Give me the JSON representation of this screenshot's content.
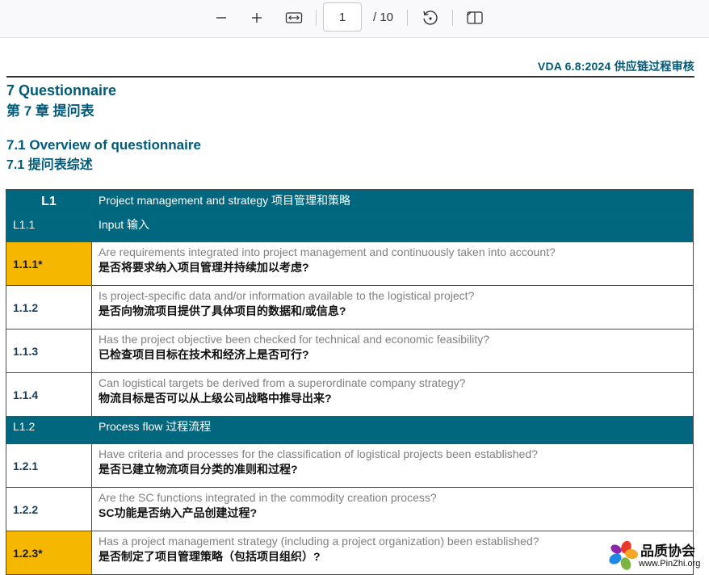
{
  "toolbar": {
    "zoom_out_icon": "minus-icon",
    "zoom_in_icon": "plus-icon",
    "fit_icon": "fit-width-icon",
    "page_value": "1",
    "page_total": "/ 10",
    "rotate_icon": "rotate-icon",
    "view_icon": "two-page-view-icon"
  },
  "document": {
    "header": "VDA  6.8:2024 供应链过程审核",
    "h1_en": "7 Questionnaire",
    "h1_cn": "第 7 章  提问表",
    "h2_en": "7.1 Overview of questionnaire",
    "h2_cn": "7.1 提问表综述"
  },
  "table": {
    "header": {
      "code": "L1",
      "title": "Project management and strategy  项目管理和策略"
    },
    "rows": [
      {
        "type": "sub",
        "code": "L1.1",
        "title": "Input  输入"
      },
      {
        "type": "item",
        "code": "1.1.1*",
        "star": true,
        "en": "Are requirements integrated into project management and continuously taken into account?",
        "cn": "是否将要求纳入项目管理并持续加以考虑?"
      },
      {
        "type": "item",
        "code": "1.1.2",
        "star": false,
        "en": "Is project-specific data and/or information available to the logistical project?",
        "cn": "是否向物流项目提供了具体项目的数据和/或信息?"
      },
      {
        "type": "item",
        "code": "1.1.3",
        "star": false,
        "en": "Has the project objective been checked for technical and economic feasibility?",
        "cn": "已检查项目目标在技术和经济上是否可行?"
      },
      {
        "type": "item",
        "code": "1.1.4",
        "star": false,
        "en": "Can logistical targets be derived from a superordinate company strategy?",
        "cn": "物流目标是否可以从上级公司战略中推导出来?"
      },
      {
        "type": "sub",
        "code": "L1.2",
        "title": "Process flow  过程流程"
      },
      {
        "type": "item",
        "code": "1.2.1",
        "star": false,
        "en": "Have criteria and processes for the classification of logistical projects been established?",
        "cn": "是否已建立物流项目分类的准则和过程?"
      },
      {
        "type": "item",
        "code": "1.2.2",
        "star": false,
        "en": "Are the SC functions integrated in the commodity creation process?",
        "cn": "SC功能是否纳入产品创建过程?"
      },
      {
        "type": "item",
        "code": "1.2.3*",
        "star": true,
        "en": "Has a project management strategy (including a project organization) been established?",
        "cn": "是否制定了项目管理策略（包括项目组织）?"
      }
    ]
  },
  "watermark": {
    "title": "品质协会",
    "url": "www.PinZhi.org"
  }
}
